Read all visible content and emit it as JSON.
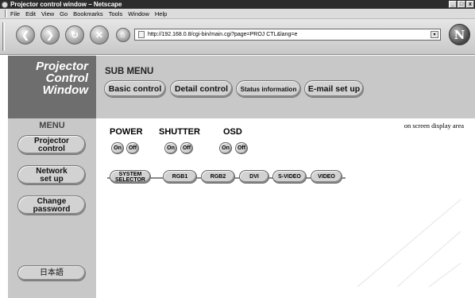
{
  "window": {
    "title": "Projector control window – Netscape",
    "controls": [
      "_",
      "□",
      "x"
    ]
  },
  "menubar": [
    "File",
    "Edit",
    "View",
    "Go",
    "Bookmarks",
    "Tools",
    "Window",
    "Help"
  ],
  "nav": {
    "back_icon": "back-arrow-icon",
    "forward_icon": "forward-arrow-icon",
    "reload_icon": "reload-icon",
    "stop_icon": "stop-icon",
    "url": "http://192.168.0.8/cgi-bin/main.cgi?page=PROJ CTL&lang=e",
    "logo_letter": "N"
  },
  "logo": {
    "line1": "Projector",
    "line2": "Control",
    "line3": "Window"
  },
  "submenu": {
    "title": "SUB MENU",
    "buttons": [
      "Basic control",
      "Detail control",
      "Status information",
      "E-mail set up"
    ]
  },
  "sidebar": {
    "title": "MENU",
    "buttons": [
      {
        "line1": "Projector",
        "line2": "control"
      },
      {
        "line1": "Network",
        "line2": "set up"
      },
      {
        "line1": "Change",
        "line2": "password"
      }
    ],
    "language_button": "日本語"
  },
  "main": {
    "note": "on screen display area",
    "groups": [
      {
        "label": "POWER",
        "on": "On",
        "off": "Off"
      },
      {
        "label": "SHUTTER",
        "on": "On",
        "off": "Off"
      },
      {
        "label": "OSD",
        "on": "On",
        "off": "Off"
      }
    ],
    "inputs": {
      "selector_line1": "SYSTEM",
      "selector_line2": "SELECTOR",
      "sources": [
        "RGB1",
        "RGB2",
        "DVI",
        "S-VIDEO",
        "VIDEO"
      ]
    }
  }
}
